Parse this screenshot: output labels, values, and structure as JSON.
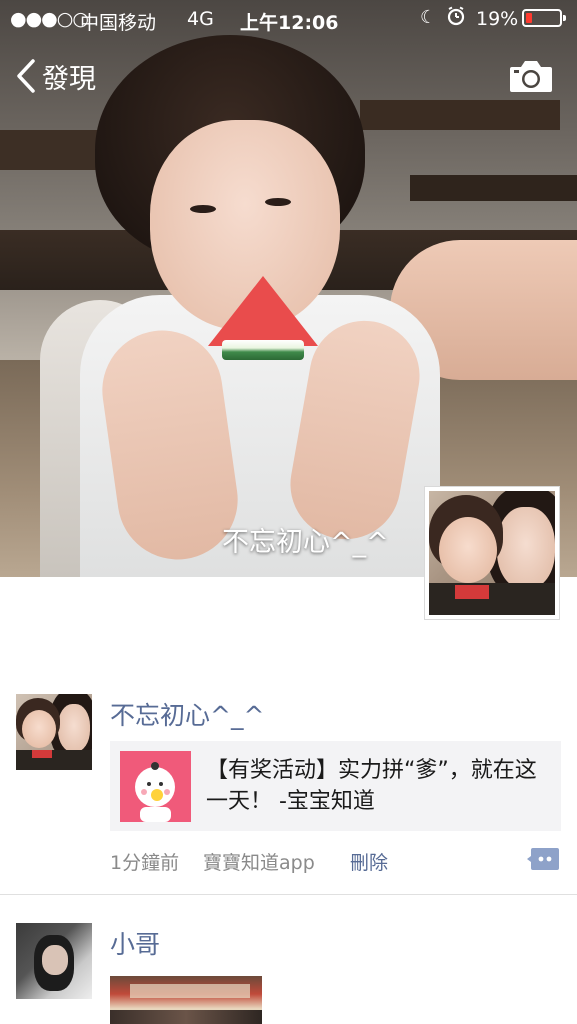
{
  "status_bar": {
    "signal": "●●●○○",
    "carrier": "中国移动",
    "network": "4G",
    "time": "上午12:06",
    "battery_percent": "19%",
    "battery_level": 0.19,
    "battery_color": "#ff3b30"
  },
  "nav": {
    "back_label": "發現",
    "back_icon": "chevron-left-icon",
    "camera_icon": "camera-icon"
  },
  "cover": {
    "caption": "不忘初心^_^"
  },
  "feed": [
    {
      "author": "不忘初心^_^",
      "share_card": {
        "text": "【有奖活动】实力拼“爹”，就在这一天！ -宝宝知道"
      },
      "time": "1分鐘前",
      "source": "寶寶知道app",
      "delete_label": "刪除",
      "comment_icon": "comment-icon"
    },
    {
      "author": "小哥"
    }
  ],
  "colors": {
    "link_blue": "#576b95",
    "meta_gray": "#8a8a8a",
    "card_bg": "#f3f3f5"
  }
}
